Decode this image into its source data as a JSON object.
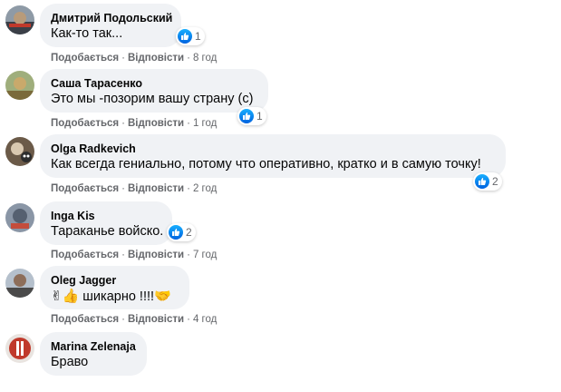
{
  "comments": [
    {
      "author": "Дмитрий Подольский",
      "text": "Как-то так...",
      "like_count": "1",
      "actions": {
        "like": "Подобається",
        "reply": "Відповісти",
        "time": "8 год"
      },
      "avatar_colors": [
        "#3a3f47",
        "#b89b7a"
      ]
    },
    {
      "author": "Саша Тарасенко",
      "text": "Это мы -позорим вашу страну (с)",
      "like_count": "1",
      "actions": {
        "like": "Подобається",
        "reply": "Відповісти",
        "time": "1 год"
      },
      "avatar_colors": [
        "#7a6a3a",
        "#c9a96b"
      ]
    },
    {
      "author": "Olga Radkevich",
      "text": "Как всегда гениально, потому что оперативно, кратко и в самую точку!",
      "like_count": "2",
      "actions": {
        "like": "Подобається",
        "reply": "Відповісти",
        "time": "2 год"
      },
      "avatar_colors": [
        "#2d2d2d",
        "#d9c8b0"
      ]
    },
    {
      "author": "Inga Kis",
      "text": "Тараканье войско.",
      "like_count": "2",
      "actions": {
        "like": "Подобається",
        "reply": "Відповісти",
        "time": "7 год"
      },
      "avatar_colors": [
        "#556070",
        "#c44d3c"
      ]
    },
    {
      "author": "Oleg Jagger",
      "text": "шикарно !!!!",
      "emoji_before": [
        "✌",
        "👍"
      ],
      "emoji_after": "🤝",
      "actions": {
        "like": "Подобається",
        "reply": "Відповісти",
        "time": "4 год"
      },
      "avatar_colors": [
        "#4a4a4a",
        "#b5c0cc"
      ]
    },
    {
      "author": "Marina Zelenaja",
      "text": "Браво",
      "avatar_colors": [
        "#c0392b",
        "#e9e4e0"
      ]
    }
  ],
  "colors": {
    "bubble": "#f0f2f5",
    "meta_text": "#65676b",
    "like_blue": "#1877f2"
  }
}
